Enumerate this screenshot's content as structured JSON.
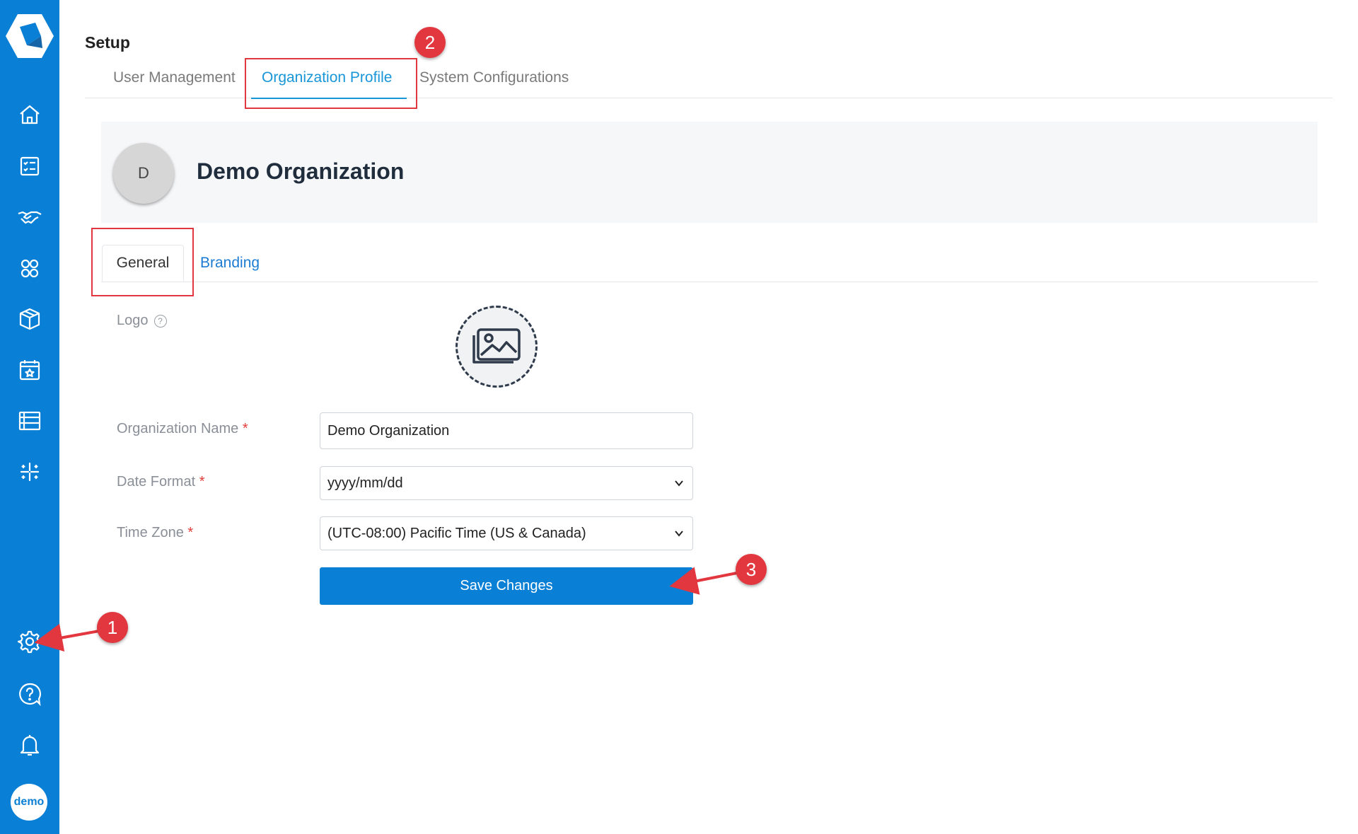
{
  "app": {
    "user_avatar_text": "demo"
  },
  "sidebar": {
    "items": [
      {
        "icon": "home-icon"
      },
      {
        "icon": "checklist-icon"
      },
      {
        "icon": "handshake-icon"
      },
      {
        "icon": "group-icon"
      },
      {
        "icon": "box-icon"
      },
      {
        "icon": "calendar-star-icon"
      },
      {
        "icon": "table-icon"
      },
      {
        "icon": "sparkle-icon"
      }
    ],
    "bottom": [
      {
        "icon": "gear-icon"
      },
      {
        "icon": "help-chat-icon"
      },
      {
        "icon": "bell-icon"
      }
    ]
  },
  "header": {
    "title": "Setup",
    "tabs": [
      {
        "label": "User Management",
        "active": false
      },
      {
        "label": "Organization Profile",
        "active": true
      },
      {
        "label": "System Configurations",
        "active": false
      }
    ]
  },
  "organization": {
    "avatar_letter": "D",
    "name": "Demo Organization"
  },
  "subtabs": {
    "general": "General",
    "branding": "Branding"
  },
  "form": {
    "logo_label": "Logo",
    "help_glyph": "?",
    "org_name_label": "Organization Name",
    "org_name_value": "Demo Organization",
    "date_format_label": "Date Format",
    "date_format_value": "yyyy/mm/dd",
    "time_zone_label": "Time Zone",
    "time_zone_value": "(UTC-08:00) Pacific Time (US & Canada)",
    "required_mark": "*",
    "save_label": "Save Changes"
  },
  "annotations": {
    "callout_1": "1",
    "callout_2": "2",
    "callout_3": "3"
  },
  "colors": {
    "sidebar": "#0a7fd6",
    "accent": "#1896d8",
    "callout_red": "#e2373f"
  }
}
